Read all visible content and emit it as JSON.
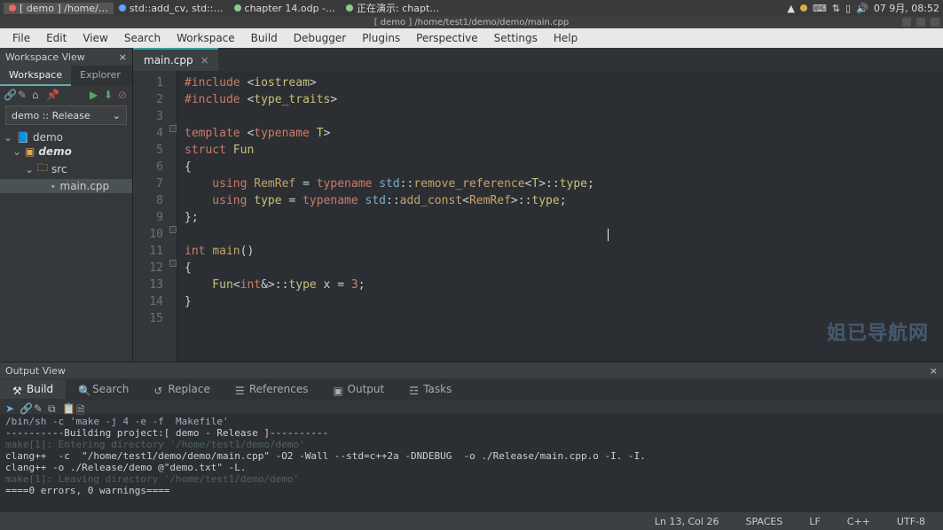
{
  "os": {
    "tasks": [
      {
        "label": "[ demo ] /home/…",
        "active": true,
        "icon": "app"
      },
      {
        "label": "std::add_cv, std::…",
        "active": false,
        "icon": "ff"
      },
      {
        "label": "chapter 14.odp -…",
        "active": false,
        "icon": "odp"
      },
      {
        "label": "正在演示: chapt…",
        "active": false,
        "icon": "odp"
      }
    ],
    "clock": "07 9月, 08:52"
  },
  "window": {
    "title": "[ demo ] /home/test1/demo/demo/main.cpp"
  },
  "menu": [
    "File",
    "Edit",
    "View",
    "Search",
    "Workspace",
    "Build",
    "Debugger",
    "Plugins",
    "Perspective",
    "Settings",
    "Help"
  ],
  "workspace": {
    "pane_title": "Workspace View",
    "tabs": [
      "Workspace",
      "Explorer"
    ],
    "active_tab": 0,
    "combo": "demo :: Release",
    "tree": {
      "root": "demo",
      "project": "demo",
      "folder": "src",
      "file": "main.cpp"
    }
  },
  "editor": {
    "tab": {
      "name": "main.cpp"
    },
    "lines_count": 15,
    "code": {
      "l1": "#include <iostream>",
      "l2": "#include <type_traits>",
      "l3": "",
      "l4": {
        "a": "template",
        "b": "<",
        "c": "typename",
        "d": "T",
        "e": ">"
      },
      "l5": {
        "a": "struct",
        "b": "Fun"
      },
      "l6": "{",
      "l7": {
        "a": "    using ",
        "b": "RemRef",
        "c": " = ",
        "d": "typename ",
        "e": "std",
        "f": "::",
        "g": "remove_reference",
        "h": "<",
        "i": "T",
        "j": ">::",
        "k": "type",
        "l": ";"
      },
      "l8": {
        "a": "    using ",
        "b": "type",
        "c": " = ",
        "d": "typename ",
        "e": "std",
        "f": "::",
        "g": "add_const",
        "h": "<",
        "i": "RemRef",
        "j": ">::",
        "k": "type",
        "l": ";"
      },
      "l9": "};",
      "l10": "",
      "l11": {
        "a": "int ",
        "b": "main",
        "c": "()"
      },
      "l12": "{",
      "l13": {
        "a": "    Fun",
        "b": "<",
        "c": "int",
        "d": "&>::",
        "e": "type",
        "f": " x ",
        "g": "= ",
        "h": "3",
        "i": ";"
      },
      "l14": "}",
      "l15": ""
    }
  },
  "output": {
    "pane_title": "Output View",
    "tabs": [
      "Build",
      "Search",
      "Replace",
      "References",
      "Output",
      "Tasks"
    ],
    "active_tab": 0,
    "console": [
      {
        "cls": "cmd",
        "t": "/bin/sh -c 'make -j 4 -e -f  Makefile'"
      },
      {
        "cls": "ok",
        "t": "----------Building project:[ demo - Release ]----------"
      },
      {
        "cls": "dim",
        "t": "make[1]: Entering directory '/home/test1/demo/demo'"
      },
      {
        "cls": "ok",
        "t": "clang++  -c  \"/home/test1/demo/demo/main.cpp\" -O2 -Wall --std=c++2a -DNDEBUG  -o ./Release/main.cpp.o -I. -I."
      },
      {
        "cls": "ok",
        "t": "clang++ -o ./Release/demo @\"demo.txt\" -L."
      },
      {
        "cls": "dim",
        "t": "make[1]: Leaving directory '/home/test1/demo/demo'"
      },
      {
        "cls": "ok",
        "t": "====0 errors, 0 warnings===="
      }
    ]
  },
  "status": {
    "pos": "Ln 13, Col 26",
    "indent": "SPACES",
    "eol": "LF",
    "lang": "C++",
    "enc": "UTF-8"
  },
  "watermark": "姐已导航网"
}
